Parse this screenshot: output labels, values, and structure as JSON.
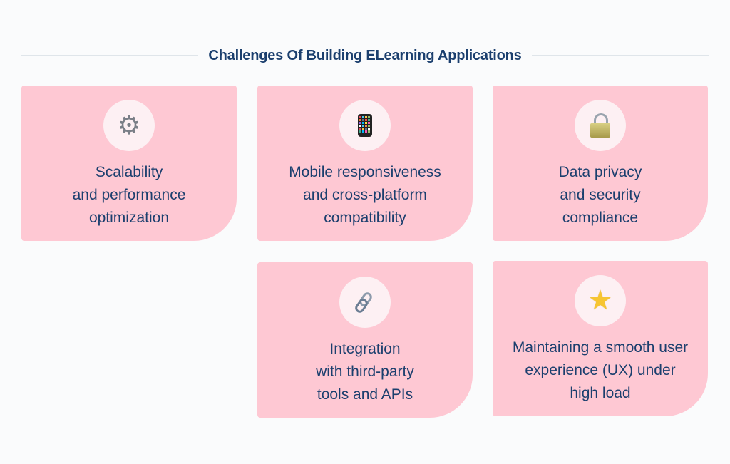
{
  "header": {
    "title": "Challenges Of Building ELearning Applications"
  },
  "colors": {
    "title": "#1b3f6e",
    "card_background": "#fec8d3",
    "icon_circle": "#fdf0f3",
    "divider": "#dfe5ea"
  },
  "cards": [
    {
      "icon": "gear-icon",
      "glyph": "⚙",
      "label": "Scalability\nand performance\noptimization"
    },
    {
      "icon": "mobile-phone-icon",
      "glyph": "",
      "label": "Mobile responsiveness\nand cross-platform\ncompatibility"
    },
    {
      "icon": "lock-icon",
      "glyph": "",
      "label": "Data privacy\nand security\ncompliance"
    },
    {
      "icon": "link-icon",
      "glyph": "🔗",
      "label": "Integration\nwith third-party\ntools and APIs"
    },
    {
      "icon": "star-icon",
      "glyph": "★",
      "label": "Maintaining a smooth user\nexperience (UX) under\nhigh load"
    }
  ]
}
